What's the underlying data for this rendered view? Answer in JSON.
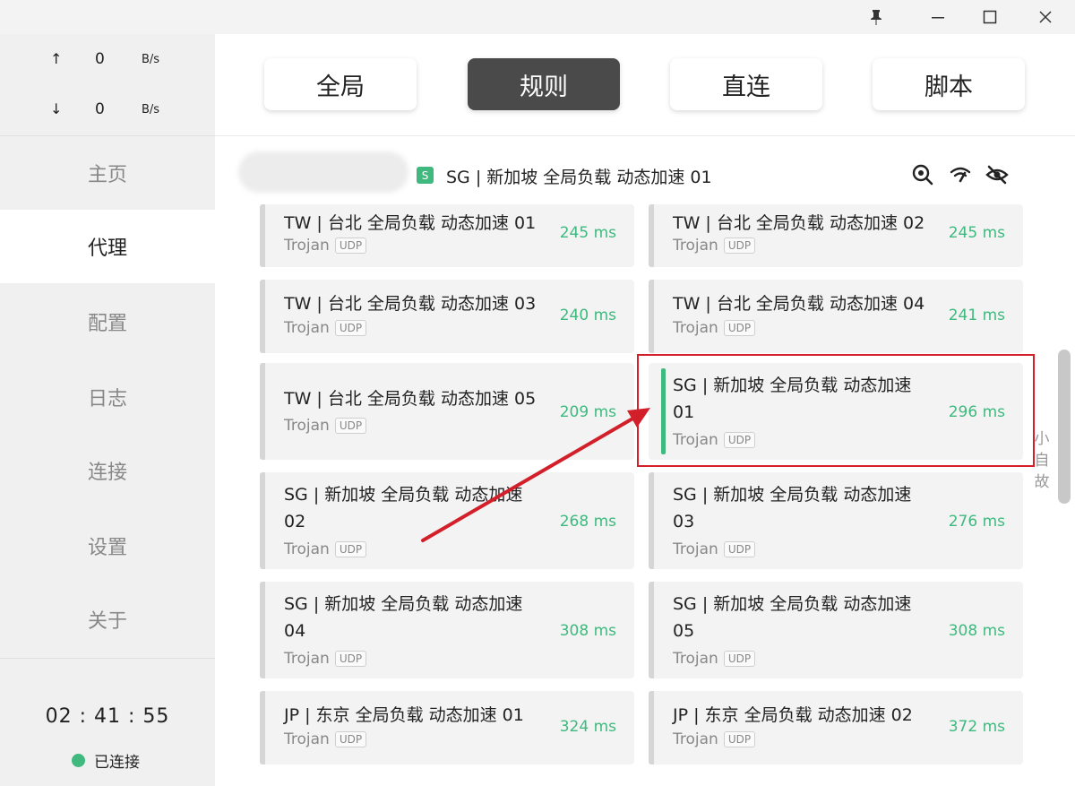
{
  "window": {
    "controls": [
      {
        "name": "pin-icon",
        "glyph": "📌"
      },
      {
        "name": "minimize-icon",
        "glyph": "—"
      },
      {
        "name": "maximize-icon",
        "glyph": "☐"
      },
      {
        "name": "close-icon",
        "glyph": "✕"
      }
    ]
  },
  "sidebar": {
    "upload": {
      "arrow": "↑",
      "value": "0",
      "unit": "B/s"
    },
    "download": {
      "arrow": "↓",
      "value": "0",
      "unit": "B/s"
    },
    "nav": [
      "主页",
      "代理",
      "配置",
      "日志",
      "连接",
      "设置",
      "关于"
    ],
    "active_index": 1,
    "timer": "02 : 41 : 55",
    "status": "已连接",
    "status_color": "#3fb97e"
  },
  "modes": {
    "items": [
      "全局",
      "规则",
      "直连",
      "脚本"
    ],
    "active_index": 1
  },
  "group": {
    "badge": "S",
    "selected_name": "SG | 新加坡 全局负载 动态加速 01",
    "icons": [
      "search-location-icon",
      "wifi-speed-icon",
      "eye-off-icon"
    ]
  },
  "proxies": [
    {
      "name": "TW | 台北 全局负载 动态加速 01",
      "type": "Trojan",
      "udp": "UDP",
      "delay": "245 ms"
    },
    {
      "name": "TW | 台北 全局负载 动态加速 02",
      "type": "Trojan",
      "udp": "UDP",
      "delay": "245 ms"
    },
    {
      "name": "TW | 台北 全局负载 动态加速 03",
      "type": "Trojan",
      "udp": "UDP",
      "delay": "240 ms"
    },
    {
      "name": "TW | 台北 全局负载 动态加速 04",
      "type": "Trojan",
      "udp": "UDP",
      "delay": "241 ms"
    },
    {
      "name": "TW | 台北 全局负载 动态加速 05",
      "type": "Trojan",
      "udp": "UDP",
      "delay": "209 ms"
    },
    {
      "name": "SG | 新加坡 全局负载 动态加速 01",
      "type": "Trojan",
      "udp": "UDP",
      "delay": "296 ms",
      "selected": true
    },
    {
      "name": "SG | 新加坡 全局负载 动态加速 02",
      "type": "Trojan",
      "udp": "UDP",
      "delay": "268 ms"
    },
    {
      "name": "SG | 新加坡 全局负载 动态加速 03",
      "type": "Trojan",
      "udp": "UDP",
      "delay": "276 ms"
    },
    {
      "name": "SG | 新加坡 全局负载 动态加速 04",
      "type": "Trojan",
      "udp": "UDP",
      "delay": "308 ms"
    },
    {
      "name": "SG | 新加坡 全局负载 动态加速 05",
      "type": "Trojan",
      "udp": "UDP",
      "delay": "308 ms"
    },
    {
      "name": "JP | 东京 全局负载 动态加速 01",
      "type": "Trojan",
      "udp": "UDP",
      "delay": "324 ms"
    },
    {
      "name": "JP | 东京 全局负载 动态加速 02",
      "type": "Trojan",
      "udp": "UDP",
      "delay": "372 ms"
    }
  ],
  "side_chars": [
    "小",
    "自",
    "故"
  ],
  "colors": {
    "accent": "#3fb97e",
    "active_mode": "#4a4a4a",
    "annotation": "#d21f2a"
  }
}
